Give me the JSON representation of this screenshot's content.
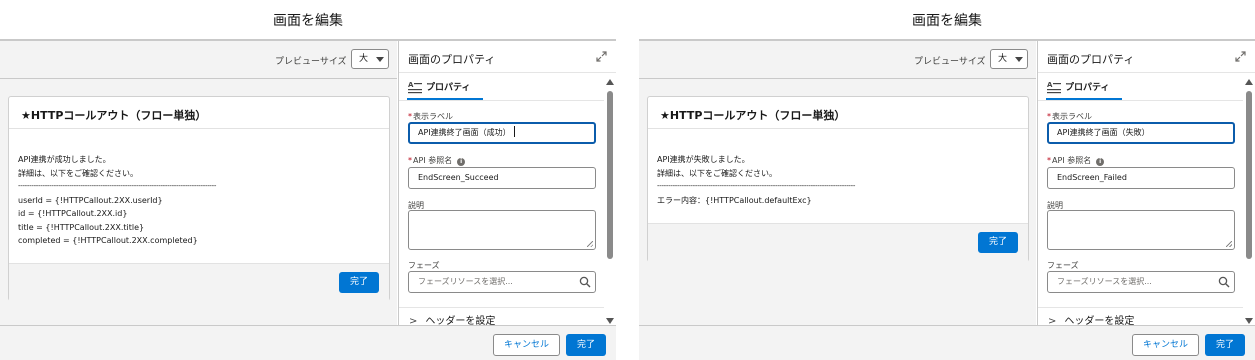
{
  "left": {
    "modal_title": "画面を編集",
    "preview_size_label": "プレビューサイズ",
    "preview_size_value": "大",
    "card": {
      "title": "★HTTPコールアウト（フロー単独）",
      "body_lines": [
        "API連携が成功しました。",
        "詳細は、以下をご確認ください。",
        "-----------------------------------------------------------------------------------------",
        "userId = {!HTTPCallout.2XX.userId}",
        "id = {!HTTPCallout.2XX.id}",
        "title = {!HTTPCallout.2XX.title}",
        "completed = {!HTTPCallout.2XX.completed}"
      ],
      "done_button": "完了"
    },
    "properties": {
      "title": "画面のプロパティ",
      "tab": "プロパティ",
      "display_label_label": "表示ラベル",
      "display_label_value": "API連携終了画面（成功）",
      "api_name_label": "API 参照名",
      "api_name_value": "EndScreen_Succeed",
      "description_label": "説明",
      "phase_label": "フェーズ",
      "phase_placeholder": "フェーズリソースを選択...",
      "header_section": "ヘッダーを設定"
    },
    "footer": {
      "cancel": "キャンセル",
      "done": "完了"
    }
  },
  "right": {
    "modal_title": "画面を編集",
    "preview_size_label": "プレビューサイズ",
    "preview_size_value": "大",
    "card": {
      "title": "★HTTPコールアウト（フロー単独）",
      "body_lines": [
        "API連携が失敗しました。",
        "詳細は、以下をご確認ください。",
        "-----------------------------------------------------------------------------------------",
        "エラー内容：{!HTTPCallout.defaultExc}"
      ],
      "done_button": "完了"
    },
    "properties": {
      "title": "画面のプロパティ",
      "tab": "プロパティ",
      "display_label_label": "表示ラベル",
      "display_label_value": "API連携終了画面（失敗）",
      "api_name_label": "API 参照名",
      "api_name_value": "EndScreen_Failed",
      "description_label": "説明",
      "phase_label": "フェーズ",
      "phase_placeholder": "フェーズリソースを選択...",
      "header_section": "ヘッダーを設定"
    },
    "footer": {
      "cancel": "キャンセル",
      "done": "完了"
    }
  },
  "colors": {
    "brand_blue": "#0176d3",
    "focus_border": "#0b5cab",
    "required_red": "#ba0517",
    "canvas_gray": "#f3f3f3"
  },
  "icons": [
    "expand-icon",
    "text-label-icon",
    "info-icon",
    "search-icon",
    "chevron-right-icon",
    "resize-grip-icon"
  ]
}
